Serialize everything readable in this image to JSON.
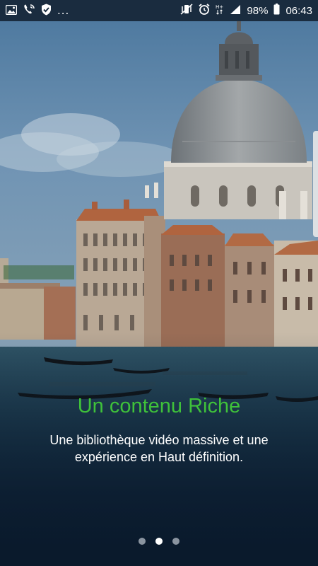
{
  "status_bar": {
    "left_icons": [
      "image-icon",
      "wifi-call-icon",
      "shield-check-icon"
    ],
    "left_more": "...",
    "right_icons": [
      "vibrate-mute-icon",
      "alarm-icon",
      "network-hplus-icon",
      "signal-icon"
    ],
    "battery_percent": "98%",
    "time": "06:43"
  },
  "slide": {
    "title": "Un contenu Riche",
    "description": "Une bibliothèque vidéo massive et une expérience en Haut définition."
  },
  "pager": {
    "count": 3,
    "active_index": 1
  },
  "colors": {
    "title": "#3fc23a",
    "status_bar_bg": "#1a2c3f",
    "dot_active": "#ffffff",
    "dot_inactive": "#8a94a0"
  }
}
